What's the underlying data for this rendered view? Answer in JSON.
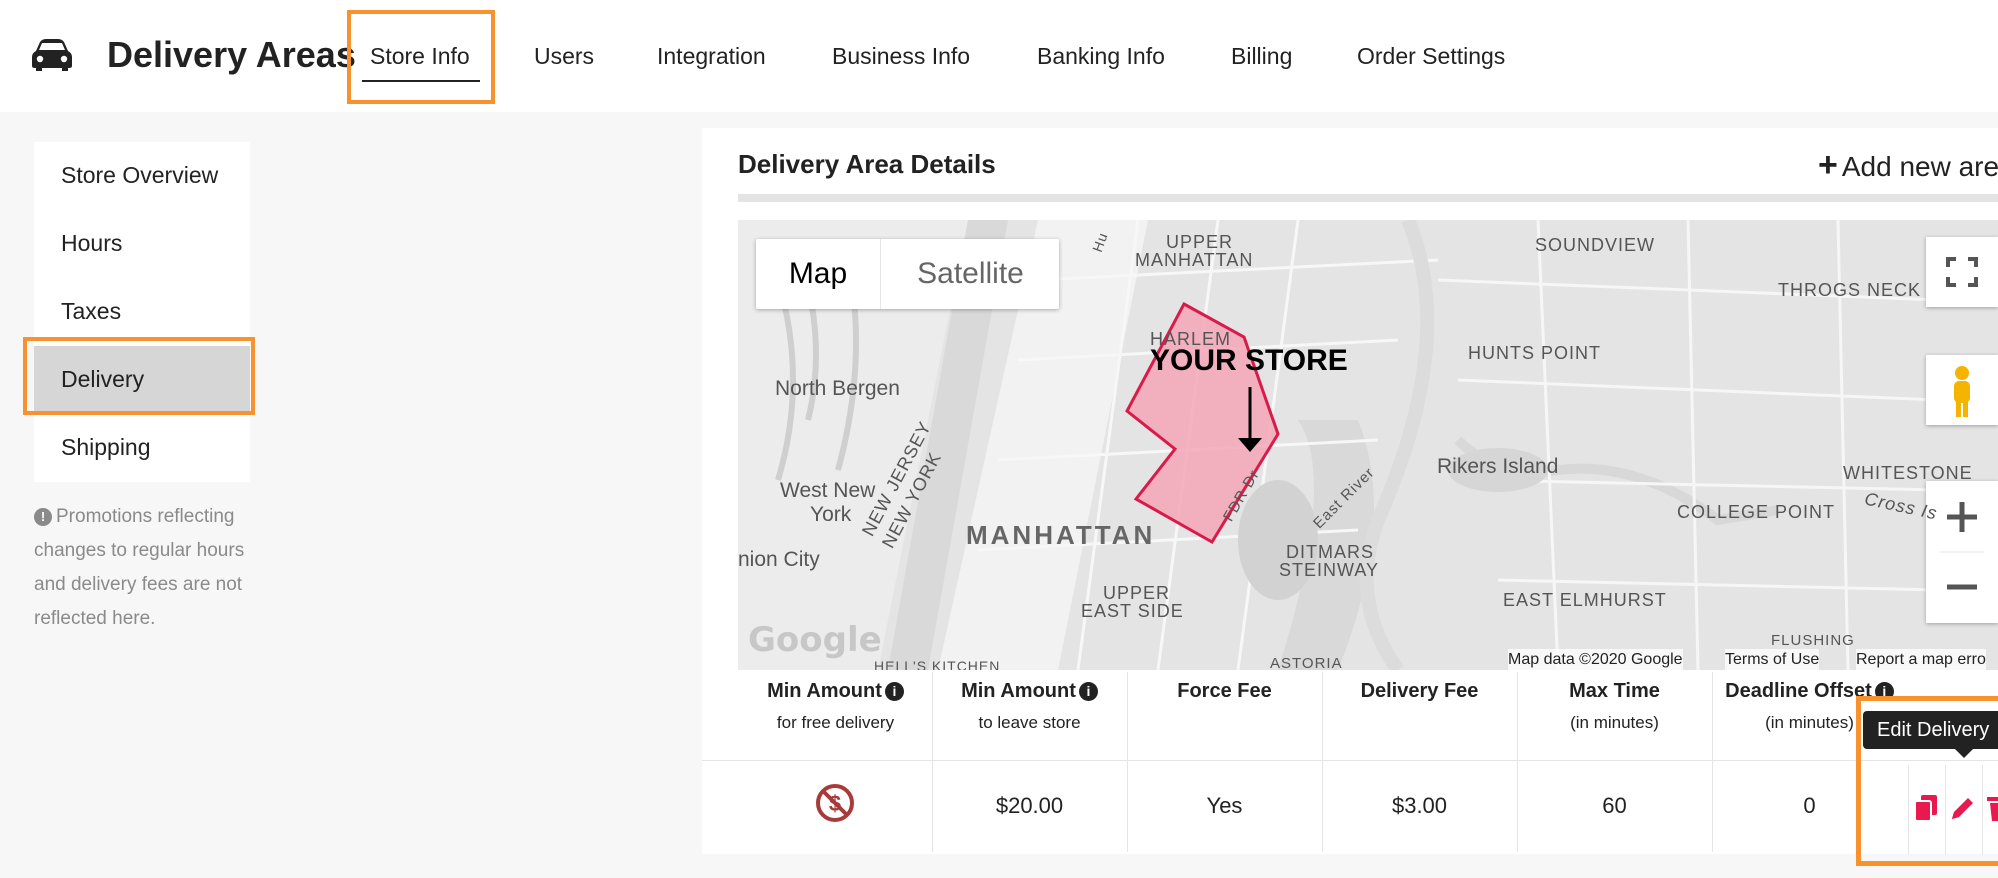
{
  "header": {
    "title": "Delivery Areas",
    "icon": "car-icon",
    "tabs": [
      {
        "label": "Store Info",
        "active": true
      },
      {
        "label": "Users"
      },
      {
        "label": "Integration"
      },
      {
        "label": "Business Info"
      },
      {
        "label": "Banking Info"
      },
      {
        "label": "Billing"
      },
      {
        "label": "Order Settings"
      }
    ]
  },
  "sidebar": {
    "items": [
      {
        "label": "Store Overview"
      },
      {
        "label": "Hours"
      },
      {
        "label": "Taxes"
      },
      {
        "label": "Delivery",
        "active": true
      },
      {
        "label": "Shipping"
      }
    ],
    "note": "Promotions reflecting changes to regular hours and delivery fees are not reflected here."
  },
  "panel": {
    "title": "Delivery Area Details",
    "add_label": "Add new are"
  },
  "map": {
    "type_buttons": {
      "map": "Map",
      "satellite": "Satellite"
    },
    "store_label": "YOUR STORE",
    "labels": {
      "upper_manhattan_1": "UPPER",
      "upper_manhattan_2": "MANHATTAN",
      "harlem": "HARLEM",
      "soundview": "SOUNDVIEW",
      "throgs_neck": "THROGS NECK",
      "hunts_point": "HUNTS POINT",
      "north_bergen": "North Bergen",
      "rikers_island": "Rikers Island",
      "whitestone": "WHITESTONE",
      "west_new_york_1": "West New",
      "west_new_york_2": "York",
      "new_jersey_1": "NEW JERSEY",
      "new_jersey_2": "NEW YORK",
      "manhattan": "MANHATTAN",
      "college_point": "COLLEGE POINT",
      "cross_is": "Cross Is",
      "union_city": "nion City",
      "fdr_dr": "FDR Dr",
      "east_river": "East River",
      "ditmars_1": "DITMARS",
      "ditmars_2": "STEINWAY",
      "upper_east_side_1": "UPPER",
      "upper_east_side_2": "EAST SIDE",
      "east_elmhurst": "EAST ELMHURST",
      "hells_kitchen": "HELL'S KITCHEN",
      "astoria": "ASTORIA",
      "flushing": "FLUSHING",
      "hudson": "Hu"
    },
    "google_logo": "Google",
    "footer": {
      "map_data": "Map data ©2020 Google",
      "terms": "Terms of Use",
      "report": "Report a map erro"
    },
    "polygon_color": "#f4a7b9",
    "polygon_stroke": "#d81b4a"
  },
  "table": {
    "columns": [
      {
        "title": "Min Amount",
        "sub": "for free delivery",
        "info": true
      },
      {
        "title": "Min Amount",
        "sub": "to leave store",
        "info": true
      },
      {
        "title": "Force Fee",
        "sub": ""
      },
      {
        "title": "Delivery Fee",
        "sub": ""
      },
      {
        "title": "Max Time",
        "sub": "(in minutes)"
      },
      {
        "title": "Deadline Offset",
        "sub": "(in minutes)",
        "info": true
      }
    ],
    "row": {
      "free_delivery_icon": "no-dollar-icon",
      "min_amount": "$20.00",
      "force_fee": "Yes",
      "delivery_fee": "$3.00",
      "max_time": "60",
      "deadline_offset": "0"
    },
    "tooltip": "Edit Delivery",
    "action_color": "#e8194e"
  },
  "highlight_color": "#f7922f"
}
